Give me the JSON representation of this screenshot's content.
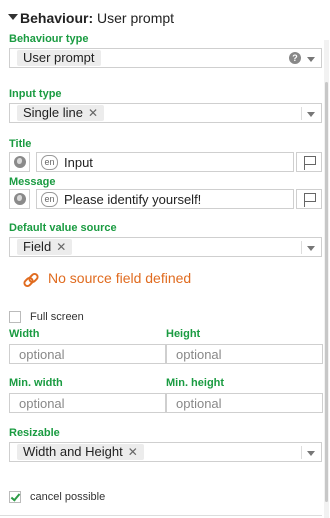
{
  "header": {
    "prefix": "Behaviour:",
    "title": "User prompt"
  },
  "behaviour_type": {
    "label": "Behaviour type",
    "value": "User prompt",
    "help": "?"
  },
  "input_type": {
    "label": "Input type",
    "value": "Single line"
  },
  "title_field": {
    "label": "Title",
    "lang": "en",
    "value": "Input"
  },
  "message_field": {
    "label": "Message",
    "lang": "en",
    "value": "Please identify yourself!"
  },
  "default_source": {
    "label": "Default value source",
    "value": "Field"
  },
  "warning": {
    "text": "No source field defined",
    "color": "#e06b1f"
  },
  "full_screen": {
    "label": "Full screen",
    "checked": false
  },
  "width": {
    "label": "Width",
    "placeholder": "optional"
  },
  "height": {
    "label": "Height",
    "placeholder": "optional"
  },
  "min_width": {
    "label": "Min. width",
    "placeholder": "optional"
  },
  "min_height": {
    "label": "Min. height",
    "placeholder": "optional"
  },
  "resizable": {
    "label": "Resizable",
    "value": "Width and Height"
  },
  "cancel_possible": {
    "label": "cancel possible",
    "checked": true
  },
  "colors": {
    "label_green": "#1a9b41",
    "warning_orange": "#e06b1f"
  },
  "icons": {
    "collapse": "triangle-down-icon",
    "globe": "globe-icon",
    "flag": "flag-icon",
    "link": "link-icon",
    "help": "help-circle-icon",
    "remove": "close-icon"
  }
}
